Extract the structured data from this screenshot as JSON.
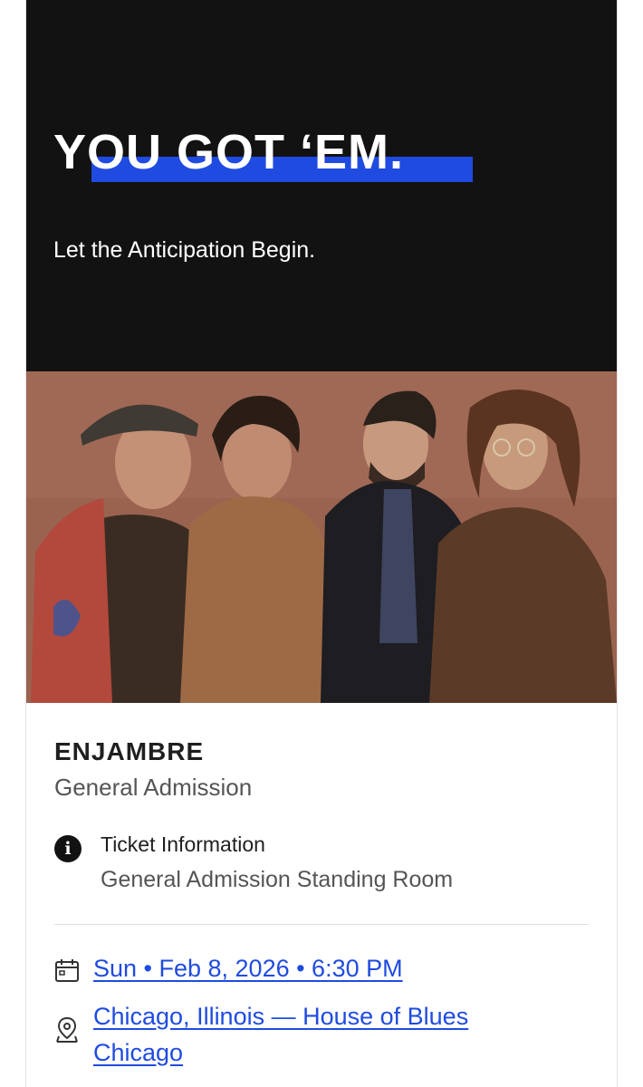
{
  "hero": {
    "headline": "YOU GOT ‘EM.",
    "subhead": "Let the Anticipation Begin.",
    "accent_color": "#1f4be0",
    "background": "#121212"
  },
  "photo": {
    "kind": "band-photo",
    "alt": "Band photo"
  },
  "event": {
    "name": "ENJAMBRE",
    "admission": "General Admission",
    "ticket_info": {
      "icon": "info-icon",
      "label": "Ticket Information",
      "value": "General Admission Standing Room"
    },
    "date": {
      "icon": "calendar-icon",
      "text": "Sun • Feb 8, 2026 • 6:30 PM"
    },
    "location": {
      "icon": "location-pin-icon",
      "text": "Chicago, Illinois — House of Blues Chicago"
    },
    "link_color": "#1f4be0"
  }
}
